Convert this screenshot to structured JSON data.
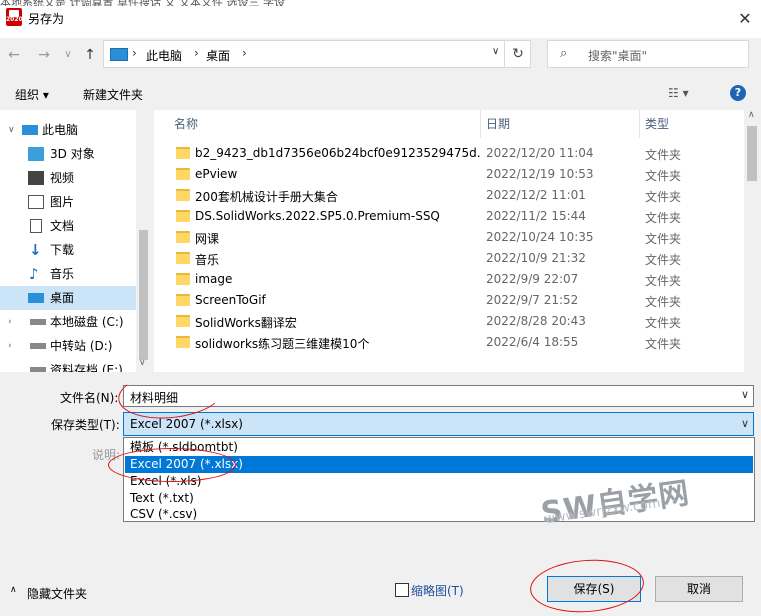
{
  "window": {
    "title": "另存为",
    "close_glyph": "✕",
    "top_strip_text": "本地系统文是    计调算置                           草件搜话   文   文本义件         选设三    学设"
  },
  "address": {
    "crumbs": [
      "此电脑",
      "桌面"
    ],
    "search_placeholder": "搜索\"桌面\""
  },
  "toolbar": {
    "organize": "组织 ▾",
    "new_folder": "新建文件夹",
    "view_glyph": "☷ ▾",
    "help": "?"
  },
  "nav": {
    "items": [
      {
        "label": "此电脑",
        "icon": "pc-icon"
      },
      {
        "label": "3D 对象",
        "icon": "cube-icon"
      },
      {
        "label": "视频",
        "icon": "video-icon"
      },
      {
        "label": "图片",
        "icon": "picture-icon"
      },
      {
        "label": "文档",
        "icon": "document-icon"
      },
      {
        "label": "下载",
        "icon": "download-icon"
      },
      {
        "label": "音乐",
        "icon": "music-icon"
      },
      {
        "label": "桌面",
        "icon": "desktop-icon"
      },
      {
        "label": "本地磁盘 (C:)",
        "icon": "drive-icon"
      },
      {
        "label": "中转站 (D:)",
        "icon": "drive-icon"
      },
      {
        "label": "资料存档 (E:)",
        "icon": "drive-icon"
      }
    ],
    "selected_index": 7
  },
  "columns": {
    "name": "名称",
    "date": "日期",
    "type": "类型"
  },
  "files": [
    {
      "name": "b2_9423_db1d7356e06b24bcf0e9123529475d...",
      "date": "2022/12/20 11:04",
      "type": "文件夹"
    },
    {
      "name": "ePview",
      "date": "2022/12/19 10:53",
      "type": "文件夹"
    },
    {
      "name": "200套机械设计手册大集合",
      "date": "2022/12/2 11:01",
      "type": "文件夹"
    },
    {
      "name": "DS.SolidWorks.2022.SP5.0.Premium-SSQ",
      "date": "2022/11/2 15:44",
      "type": "文件夹"
    },
    {
      "name": "网课",
      "date": "2022/10/24 10:35",
      "type": "文件夹"
    },
    {
      "name": "音乐",
      "date": "2022/10/9 21:32",
      "type": "文件夹"
    },
    {
      "name": "image",
      "date": "2022/9/9 22:07",
      "type": "文件夹"
    },
    {
      "name": "ScreenToGif",
      "date": "2022/9/7 21:52",
      "type": "文件夹"
    },
    {
      "name": "SolidWorks翻译宏",
      "date": "2022/8/28 20:43",
      "type": "文件夹"
    },
    {
      "name": "solidworks练习题三维建模10个",
      "date": "2022/6/4 18:55",
      "type": "文件夹"
    }
  ],
  "form": {
    "filename_label": "文件名(N):",
    "filename_value": "材料明细",
    "savetype_label": "保存类型(T):",
    "savetype_value": "Excel 2007 (*.xlsx)",
    "desc_label": "说明:",
    "options": [
      "模板 (*.sldbomtbt)",
      "Excel 2007 (*.xlsx)",
      "Excel (*.xls)",
      "Text (*.txt)",
      "CSV (*.csv)"
    ],
    "highlighted_option": 1
  },
  "footer": {
    "hide_folders": "隐藏文件夹",
    "thumbnail": "缩略图(T)",
    "save": "保存(S)",
    "cancel": "取消"
  },
  "watermark": {
    "main": "SW自学网",
    "url": "www.swrjzxw.com"
  }
}
